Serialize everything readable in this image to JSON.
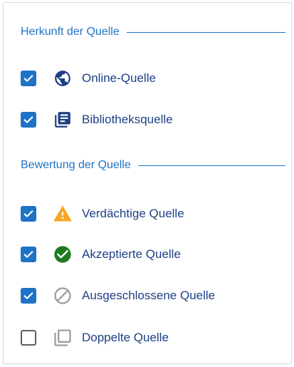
{
  "sections": [
    {
      "title": "Herkunft der Quelle",
      "items": [
        {
          "label": "Online-Quelle",
          "checked": true,
          "icon": "globe-icon",
          "icon_color": "#1d3f86"
        },
        {
          "label": "Bibliotheksquelle",
          "checked": true,
          "icon": "library-books-icon",
          "icon_color": "#1d3f86"
        }
      ]
    },
    {
      "title": "Bewertung der Quelle",
      "items": [
        {
          "label": "Verdächtige Quelle",
          "checked": true,
          "icon": "warning-icon",
          "icon_color": "#f5a623"
        },
        {
          "label": "Akzeptierte Quelle",
          "checked": true,
          "icon": "check-circle-icon",
          "icon_color": "#1f7a1f"
        },
        {
          "label": "Ausgeschlossene Quelle",
          "checked": true,
          "icon": "block-icon",
          "icon_color": "#9e9e9e"
        },
        {
          "label": "Doppelte Quelle",
          "checked": false,
          "icon": "duplicate-icon",
          "icon_color": "#9e9e9e"
        }
      ]
    }
  ],
  "colors": {
    "accent": "#1f73c6",
    "label_text": "#1d3f86"
  }
}
